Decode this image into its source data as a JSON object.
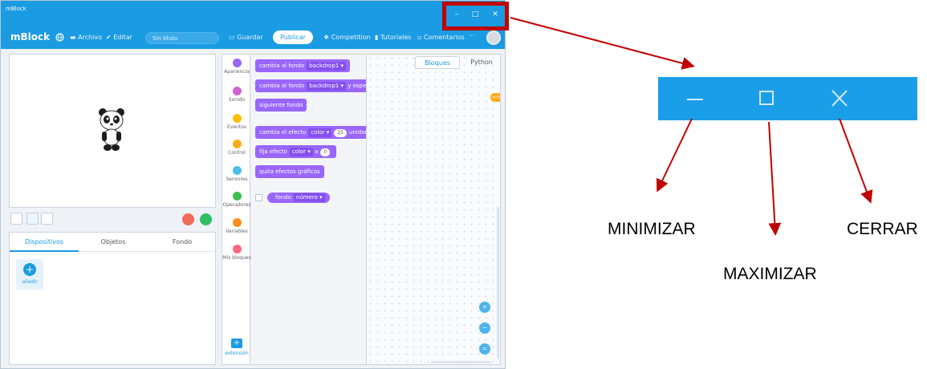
{
  "titlebar": {
    "app_name": "mBlock",
    "min_glyph": "–",
    "max_glyph": "□",
    "close_glyph": "✕"
  },
  "menubar": {
    "brand": "mBlock",
    "file": "Archivo",
    "edit": "Editar",
    "project_title": "Sin título",
    "save": "Guardar",
    "publish": "Publicar",
    "competition": "Competition",
    "tutorials": "Tutoriales",
    "comments": "Comentarios",
    "more": "···"
  },
  "panel_tabs": [
    "Dispositivos",
    "Objetos",
    "Fondo"
  ],
  "add_label": "añadir",
  "categories": [
    {
      "name": "Apariencia",
      "color": "#9966ff"
    },
    {
      "name": "Sonido",
      "color": "#cf63cf"
    },
    {
      "name": "Eventos",
      "color": "#ffbf00"
    },
    {
      "name": "Control",
      "color": "#ffab19"
    },
    {
      "name": "Sensores",
      "color": "#4cbfe6"
    },
    {
      "name": "Operadores",
      "color": "#40bf4a"
    },
    {
      "name": "Variables",
      "color": "#ff8c1a"
    },
    {
      "name": "Mis bloques",
      "color": "#ff6680"
    }
  ],
  "extension_label": "extensión",
  "blocks": {
    "switch_backdrop": "cambia al fondo",
    "backdrop_value": "backdrop1 ▾",
    "switch_backdrop_wait_suffix": "y espe",
    "next_backdrop": "siguiente fondo",
    "change_effect": "cambia el efecto",
    "effect_value": "color ▾",
    "change_amount": "25",
    "change_suffix": "unidad",
    "set_effect": "fija efecto",
    "set_effect_a": "a",
    "set_amount": "0",
    "clear_effects": "quita efectos gráficos",
    "backdrop_reporter": "fondo",
    "reporter_value": "número ▾"
  },
  "code_tabs": [
    "Bloques",
    "Python"
  ],
  "code_badge": "</>",
  "zoom": {
    "in": "+",
    "out": "−",
    "reset": "="
  },
  "annotations": {
    "minimize": "MINIMIZAR",
    "maximize": "MAXIMIZAR",
    "close": "CERRAR"
  },
  "colors": {
    "brand_blue": "#1a9be2",
    "highlight_red": "#c00000",
    "looks_purple": "#9966ff"
  }
}
